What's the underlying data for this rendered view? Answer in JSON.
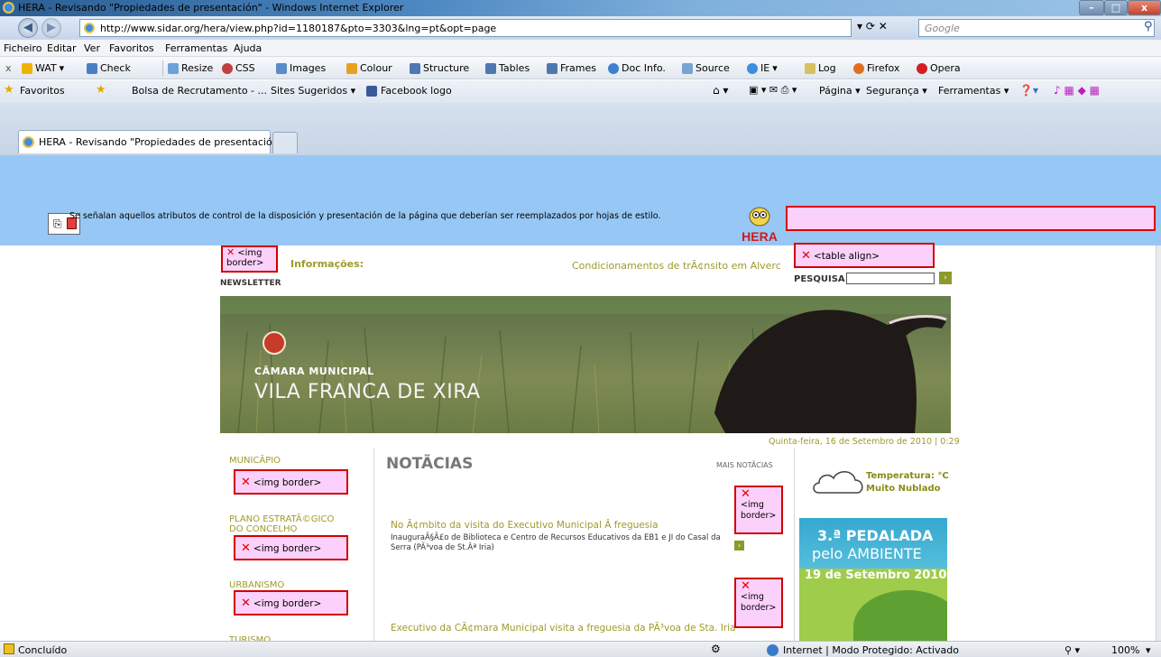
{
  "window": {
    "title": "HERA - Revisando \"Propiedades de presentación\" - Windows Internet Explorer",
    "minimize": "–",
    "maximize": "□",
    "close": "x"
  },
  "address": {
    "back": "◀",
    "forward": "▶",
    "url": "http://www.sidar.org/hera/view.php?id=1180187&pto=3303&lng=pt&opt=page",
    "search_placeholder": "Google",
    "search_icon": "⚲"
  },
  "menu": [
    "Ficheiro",
    "Editar",
    "Ver",
    "Favoritos",
    "Ferramentas",
    "Ajuda"
  ],
  "toolbar": {
    "close": "x",
    "items": [
      "WAT",
      "Check",
      "Resize",
      "CSS",
      "Images",
      "Colour",
      "Structure",
      "Tables",
      "Frames",
      "Doc Info.",
      "Source",
      "IE",
      "Log",
      "Firefox",
      "Opera"
    ]
  },
  "favorites": {
    "favorites_label": "Favoritos",
    "links": [
      "Bolsa de Recrutamento - ...",
      "Sites Sugeridos ▾",
      "Facebook logo"
    ],
    "right": [
      "Página ▾",
      "Segurança ▾",
      "Ferramentas ▾"
    ]
  },
  "tab": {
    "title": "HERA - Revisando \"Propiedades de presentación\""
  },
  "hera": {
    "message": "Se señalan aquellos atributos de control de la disposición y presentación de la página que deberían ser reemplazados por hojas de estilo.",
    "logo_text": "HERA"
  },
  "page": {
    "img_border_top": "<img border>",
    "info_label": "Informações:",
    "ticker": "Condicionamentos de trÃ¢nsito em Alverca (",
    "table_align": "<table align>",
    "pesquisa": "PESQUISA",
    "newsletter": "NEWSLETTER",
    "banner_line1": "CÂMARA MUNICIPAL",
    "banner_line2": "VILA FRANCA DE XIRA",
    "date": "Quinta-feira, 16 de Setembro de 2010 | 0:29",
    "nav": [
      {
        "label": "MUNICÃPIO",
        "badge": "<img border>"
      },
      {
        "label": "PLANO ESTRATÃ©GICO DO CONCELHO",
        "badge": "<img border>"
      },
      {
        "label": "URBANISMO",
        "badge": "<img border>"
      },
      {
        "label": "TURISMO"
      }
    ],
    "news_title": "NOTÃCIAS",
    "mais": "MAIS NOTÃCIAS",
    "news": [
      {
        "title": "No Ã¢mbito da visita do Executivo Municipal Â freguesia",
        "body": "InauguraÃ§Ã£o de Biblioteca e Centro de Recursos Educativos da EB1 e JI do Casal da Serra (PÃ³voa de St.Âª Iria)",
        "badge": "<img border>"
      },
      {
        "title": "Executivo da CÃ¢mara Municipal visita a freguesia da PÃ³voa de Sta. Iria",
        "badge": "<img border>"
      }
    ],
    "weather_label": "Temperatura:",
    "weather_unit": "°C",
    "weather_state": "Muito Nublado",
    "promo_line1": "3.ª PEDALADA",
    "promo_line2": "pelo AMBIENTE",
    "promo_date": "19 de Setembro 2010"
  },
  "status": {
    "text": "Concluído",
    "zone": "Internet | Modo Protegido: Activado",
    "zoom": "100%"
  },
  "colors": {
    "hera_bg": "#97c7f4",
    "flag_pink": "#fbd1fb",
    "flag_red": "#d00000",
    "link_gold": "#9e9b2a"
  }
}
